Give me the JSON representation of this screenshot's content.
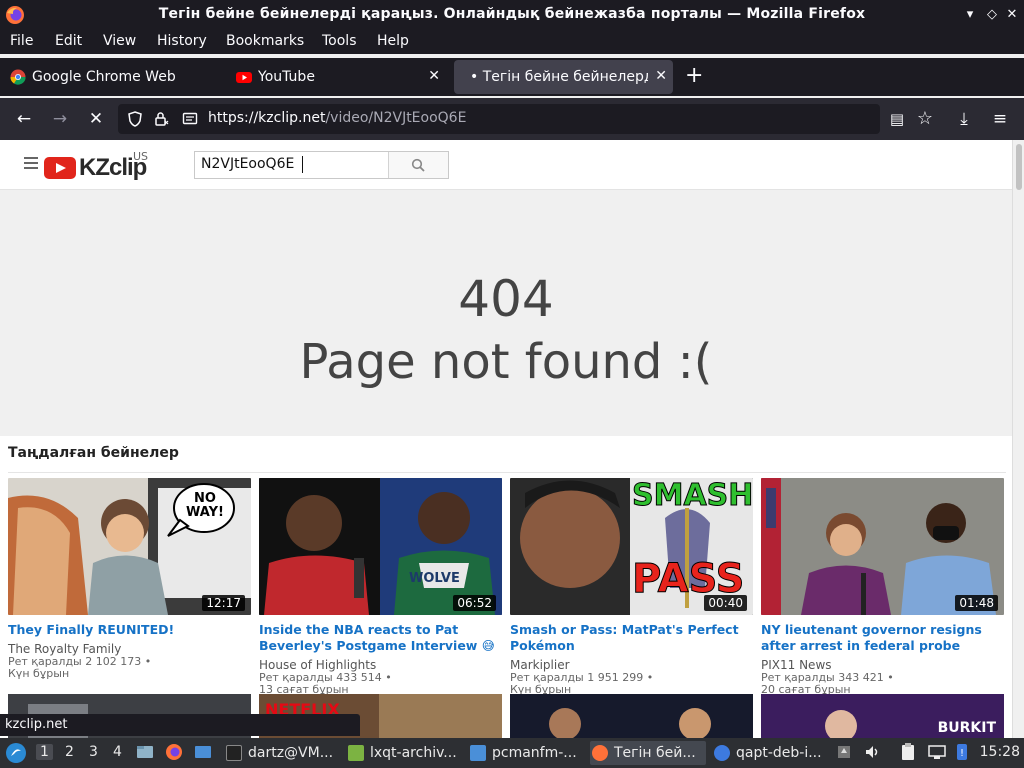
{
  "window": {
    "title": "Тегін бейне бейнелерді қараңыз. Онлайндық бейнежазба порталы — Mozilla Firefox"
  },
  "menubar": {
    "items": [
      "File",
      "Edit",
      "View",
      "History",
      "Bookmarks",
      "Tools",
      "Help"
    ]
  },
  "tabs": [
    {
      "label": "Google Chrome Web Brow",
      "active": false
    },
    {
      "label": "YouTube",
      "active": false
    },
    {
      "label": "• Тегін бейне бейнелерді",
      "active": true
    }
  ],
  "toolbar": {
    "url_host": "https://kzclip.net",
    "url_path": "/video/N2VJtEooQ6E"
  },
  "site": {
    "brand": "KZclip",
    "region": "US",
    "search_value": "N2VJtEooQ6E"
  },
  "error": {
    "code": "404",
    "message": "Page not found :("
  },
  "featured": {
    "heading": "Таңдалған бейнелер",
    "videos": [
      {
        "title": "They Finally REUNITED!",
        "channel": "The Royalty Family",
        "views": "Рет қаралды 2 102 173 •",
        "age": "Күн бұрын",
        "duration": "12:17"
      },
      {
        "title": "Inside the NBA reacts to Pat Beverley's Postgame Interview 😅",
        "channel": "House of Highlights",
        "views": "Рет қаралды 433 514 •",
        "age": "13 сағат бұрын",
        "duration": "06:52"
      },
      {
        "title": "Smash or Pass: MatPat's Perfect Pokémon",
        "channel": "Markiplier",
        "views": "Рет қаралды 1 951 299 •",
        "age": "Күн бұрын",
        "duration": "00:40"
      },
      {
        "title": "NY lieutenant governor resigns after arrest in federal probe",
        "channel": "PIX11 News",
        "views": "Рет қаралды 343 421 •",
        "age": "20 сағат бұрын",
        "duration": "01:48"
      }
    ],
    "thumb_text": {
      "no_way": "NO WAY!",
      "smash": "SMASH",
      "pass": "PASS",
      "netflix": "NETFLIX",
      "burkit": "BURKIT"
    }
  },
  "status": {
    "link": "kzclip.net"
  },
  "taskbar": {
    "workspaces": [
      "1",
      "2",
      "3",
      "4"
    ],
    "tasks": [
      "dartz@VM...",
      "lxqt-archiv...",
      "pcmanfm-...",
      "Тегін бей...",
      "qapt-deb-i..."
    ],
    "clock": "15:28"
  },
  "colors": {
    "browser_dark": "#1c1b22",
    "link_blue": "#1672c6",
    "youtube_red": "#e1251b"
  }
}
